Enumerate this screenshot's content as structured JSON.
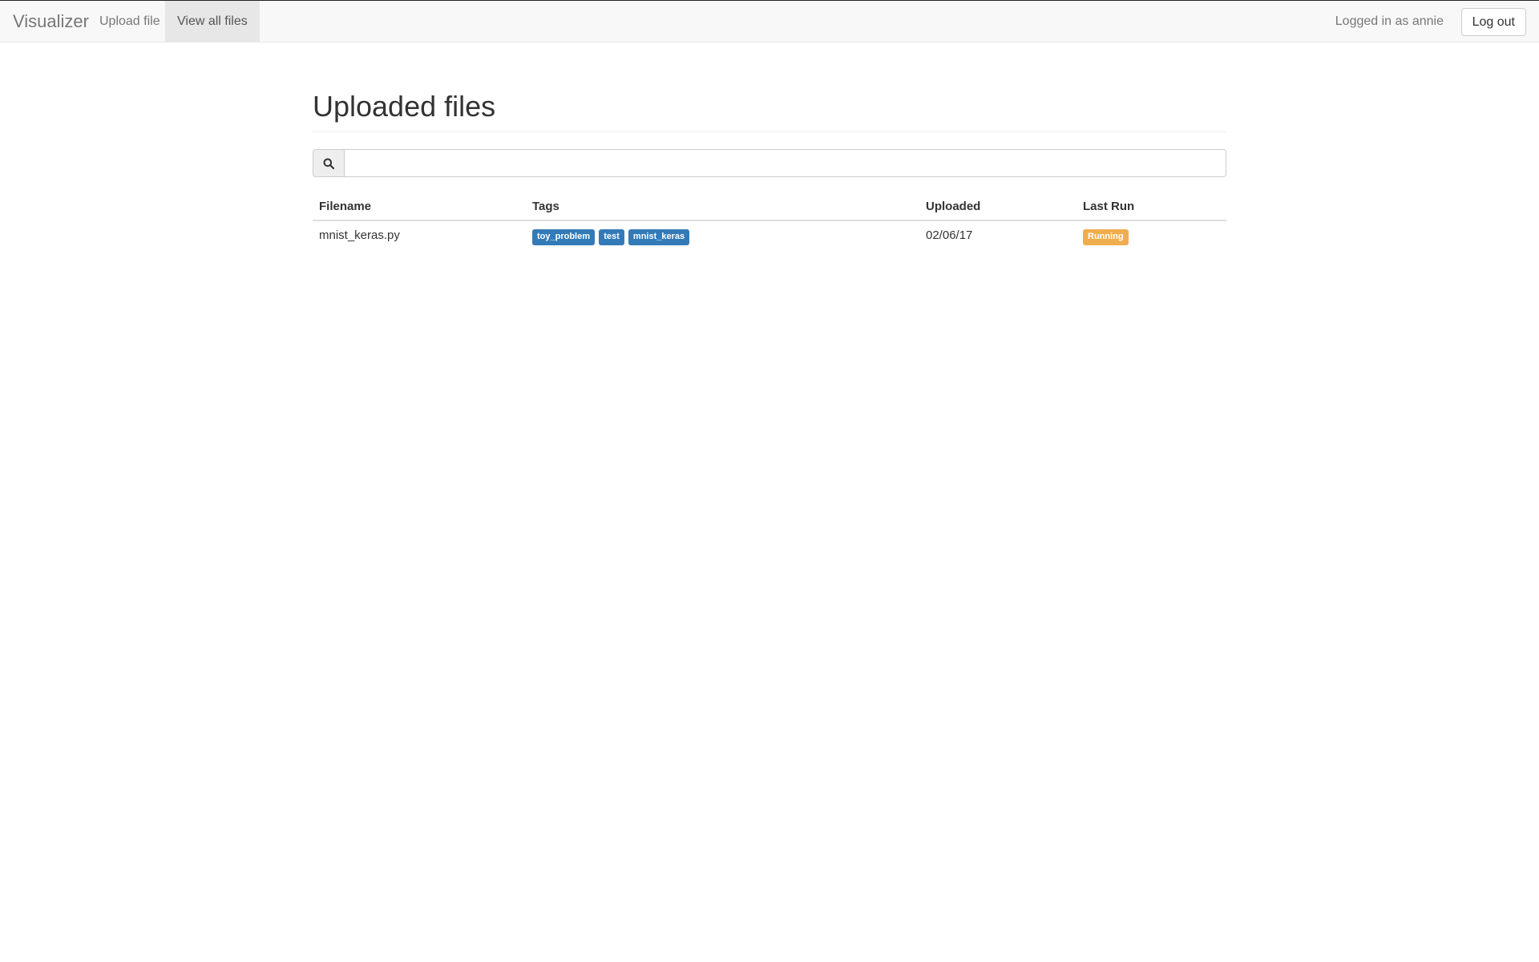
{
  "navbar": {
    "brand": "Visualizer",
    "links": [
      {
        "label": "Upload file",
        "active": false
      },
      {
        "label": "View all files",
        "active": true
      }
    ],
    "user_text": "Logged in as annie",
    "logout_label": "Log out"
  },
  "main": {
    "title": "Uploaded files",
    "search": {
      "placeholder": "",
      "value": "",
      "icon": "search-icon"
    }
  },
  "table": {
    "headers": [
      "Filename",
      "Tags",
      "Uploaded",
      "Last Run"
    ],
    "rows": [
      {
        "filename": "mnist_keras.py",
        "tags": [
          "toy_problem",
          "test",
          "mnist_keras"
        ],
        "uploaded": "02/06/17",
        "last_run": "Running"
      }
    ]
  },
  "colors": {
    "tag": "#337ab7",
    "running": "#f0ad4e",
    "navbar_bg": "#f8f8f8"
  }
}
